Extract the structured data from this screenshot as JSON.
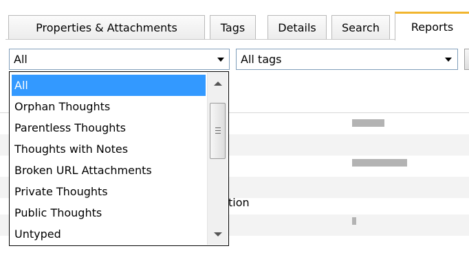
{
  "tabs": [
    {
      "label": "Properties & Attachments"
    },
    {
      "label": "Tags"
    },
    {
      "label": "Details"
    },
    {
      "label": "Search"
    },
    {
      "label": "Reports"
    }
  ],
  "filters": {
    "report_type": {
      "value": "All"
    },
    "tag_filter": {
      "value": "All tags"
    }
  },
  "dropdown": {
    "options": [
      {
        "label": "All",
        "selected": true
      },
      {
        "label": "Orphan Thoughts"
      },
      {
        "label": "Parentless Thoughts"
      },
      {
        "label": "Thoughts with Notes"
      },
      {
        "label": "Broken URL Attachments"
      },
      {
        "label": "Private Thoughts"
      },
      {
        "label": "Public Thoughts"
      },
      {
        "label": "Untyped"
      }
    ]
  },
  "background": {
    "partial_text": "tion"
  },
  "colors": {
    "selection": "#3399ff",
    "active_tab_accent": "#f1b52e"
  }
}
